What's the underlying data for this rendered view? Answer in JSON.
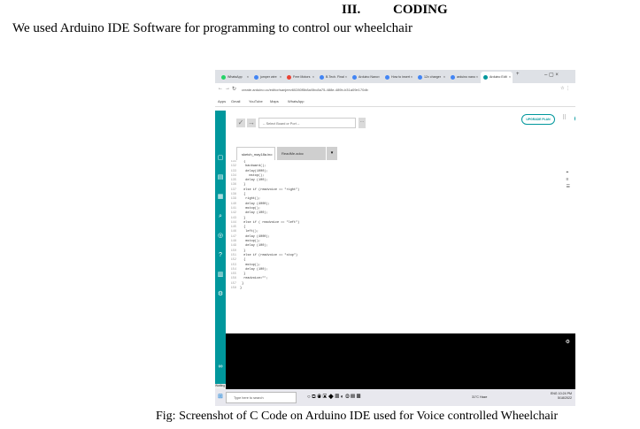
{
  "section": {
    "number": "III.",
    "title": "CODING"
  },
  "intro": "We used Arduino IDE Software for programming to control our wheelchair",
  "caption": "Fig: Screenshot of C Code on Arduino IDE used for Voice controlled Wheelchair",
  "screenshot": {
    "browser_tabs": [
      {
        "label": "WhatsApp",
        "color": "#25d366"
      },
      {
        "label": "jumper wire",
        "color": "#4285f4"
      },
      {
        "label": "Free Motors",
        "color": "#ea4335"
      },
      {
        "label": "B.Tech. Final",
        "color": "#4285f4"
      },
      {
        "label": "Arduino Nano",
        "color": "#4285f4"
      },
      {
        "label": "How to insert",
        "color": "#4285f4"
      },
      {
        "label": "12v charger",
        "color": "#4285f4"
      },
      {
        "label": "arduino nano",
        "color": "#4285f4"
      },
      {
        "label": "Arduino Edit",
        "color": "#00979c"
      }
    ],
    "url": "create.arduino.cc/editor/sanjeev60280f5b8a/0bc8a75-488e-489b-b31a09e170db",
    "bookmarks": [
      "Apps",
      "Gmail",
      "YouTube",
      "Maps",
      "WhatsApp"
    ],
    "board_placeholder": "-- Select Board or Port --",
    "upgrade_label": "UPGRADE PLAN",
    "file_tabs": [
      "sketch_may18a.ino",
      "ReadMe.adoc"
    ],
    "code_lines": [
      {
        "n": "131",
        "t": "  {"
      },
      {
        "n": "132",
        "t": "   backward();"
      },
      {
        "n": "133",
        "t": "   delay(1000);"
      },
      {
        "n": "134",
        "t": "     mstop();"
      },
      {
        "n": "135",
        "t": "   delay (100);"
      },
      {
        "n": "136",
        "t": "  }"
      },
      {
        "n": "137",
        "t": "  else if (readvoice == \"right\")"
      },
      {
        "n": "138",
        "t": "  {"
      },
      {
        "n": "139",
        "t": "   right();"
      },
      {
        "n": "140",
        "t": "   delay (4000);"
      },
      {
        "n": "141",
        "t": "   mstop();"
      },
      {
        "n": "142",
        "t": "   delay (100);"
      },
      {
        "n": "143",
        "t": "  }"
      },
      {
        "n": "144",
        "t": "  else if ( readvoice == \"left\")"
      },
      {
        "n": "145",
        "t": "  {"
      },
      {
        "n": "146",
        "t": "   left();"
      },
      {
        "n": "147",
        "t": "   delay (4000);"
      },
      {
        "n": "148",
        "t": "   mstop();"
      },
      {
        "n": "149",
        "t": "   delay (100);"
      },
      {
        "n": "150",
        "t": "  }"
      },
      {
        "n": "151",
        "t": "  else if (readvoice == \"stop\")"
      },
      {
        "n": "152",
        "t": "  {"
      },
      {
        "n": "153",
        "t": "   mstop();"
      },
      {
        "n": "154",
        "t": "   delay (100);"
      },
      {
        "n": "155",
        "t": "  }"
      },
      {
        "n": "156",
        "t": "  readvoice=\"\";"
      },
      {
        "n": "157",
        "t": " }"
      },
      {
        "n": "158",
        "t": "}"
      }
    ],
    "status_text": "Waiting for api2.arduin...",
    "search_placeholder": "Type here to search",
    "weather": "31°C Haze",
    "clock_time": "10:24 PM",
    "clock_date": "5/18/2022",
    "lang": "ENG"
  }
}
